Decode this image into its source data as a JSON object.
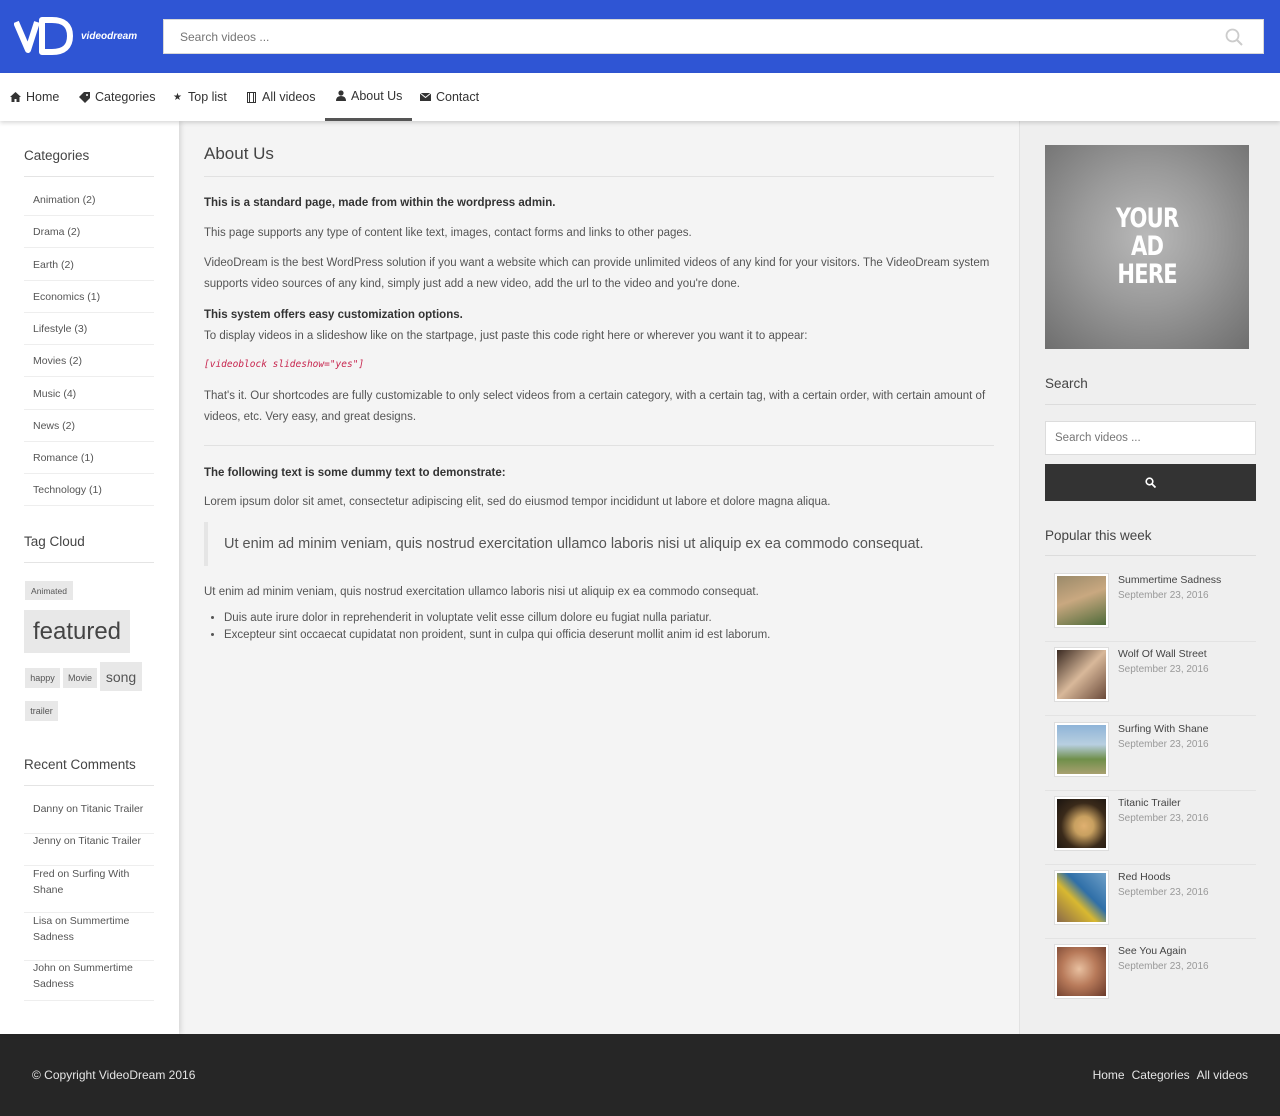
{
  "brand": {
    "name": "videodream",
    "logo_letters": "VD"
  },
  "search": {
    "placeholder": "Search videos ..."
  },
  "nav": [
    {
      "label": "Home",
      "icon": "home-icon"
    },
    {
      "label": "Categories",
      "icon": "tag-icon"
    },
    {
      "label": "Top list",
      "icon": "star-icon"
    },
    {
      "label": "All videos",
      "icon": "film-icon"
    },
    {
      "label": "About Us",
      "icon": "user-icon",
      "active": true
    },
    {
      "label": "Contact",
      "icon": "envelope-icon"
    }
  ],
  "left": {
    "categories_title": "Categories",
    "categories": [
      "Animation (2)",
      "Drama (2)",
      "Earth (2)",
      "Economics (1)",
      "Lifestyle (3)",
      "Movies (2)",
      "Music (4)",
      "News (2)",
      "Romance (1)",
      "Technology (1)"
    ],
    "tagcloud_title": "Tag Cloud",
    "tags": [
      "Animated",
      "featured",
      "happy",
      "Movie",
      "song",
      "trailer"
    ],
    "comments_title": "Recent Comments",
    "comments": [
      "Danny on Titanic Trailer",
      "Jenny on Titanic Trailer",
      "Fred on Surfing With Shane",
      "Lisa on Summertime Sadness",
      "John on Summertime Sadness"
    ]
  },
  "main": {
    "title": "About Us",
    "p1": "This is a standard page, made from within the wordpress admin.",
    "p2": "This page supports any type of content like text, images, contact forms and links to other pages.",
    "p3": "VideoDream is the best WordPress solution if you want a website which can provide unlimited videos of any kind for your visitors. The VideoDream system supports video sources of any kind, simply just add a new video, add the url to the video and you're done.",
    "p4_title": "This system offers easy customization options.",
    "p4": "To display videos in a slideshow like on the startpage, just paste this code right here or wherever you want it to appear:",
    "code": "[videoblock slideshow=\"yes\"]",
    "p5": "That's it. Our shortcodes are fully customizable to only select videos from a certain category, with a certain tag, with a certain order, with certain amount of videos, etc. Very easy, and great designs.",
    "p6_title": "The following text is some dummy text to demonstrate:",
    "p6": "Lorem ipsum dolor sit amet, consectetur adipiscing elit, sed do eiusmod tempor incididunt ut labore et dolore magna aliqua.",
    "quote": "Ut enim ad minim veniam, quis nostrud exercitation ullamco laboris nisi ut aliquip ex ea commodo consequat.",
    "p7": "Ut enim ad minim veniam, quis nostrud exercitation ullamco laboris nisi ut aliquip ex ea commodo consequat.",
    "bullets": [
      "Duis aute irure dolor in reprehenderit in voluptate velit esse cillum dolore eu fugiat nulla pariatur.",
      "Excepteur sint occaecat cupidatat non proident, sunt in culpa qui officia deserunt mollit anim id est laborum."
    ]
  },
  "right": {
    "ad_lines": [
      "YOUR",
      "AD",
      "HERE"
    ],
    "search_title": "Search",
    "search_placeholder": "Search videos ...",
    "popular_title": "Popular this week",
    "popular": [
      {
        "title": "Summertime Sadness",
        "date": "September 23, 2016",
        "colors": [
          "#8a7a5a",
          "#c9a880",
          "#4f6b3a"
        ]
      },
      {
        "title": "Wolf Of Wall Street",
        "date": "September 23, 2016",
        "colors": [
          "#6a4a3a",
          "#d8b89a",
          "#3a2a22"
        ]
      },
      {
        "title": "Surfing With Shane",
        "date": "September 23, 2016",
        "colors": [
          "#8fb4d8",
          "#6f8f4a",
          "#d8d0b8"
        ]
      },
      {
        "title": "Titanic Trailer",
        "date": "September 23, 2016",
        "colors": [
          "#3a2a1a",
          "#c8a060",
          "#1a1410"
        ]
      },
      {
        "title": "Red Hoods",
        "date": "September 23, 2016",
        "colors": [
          "#2f6fa8",
          "#d8b830",
          "#8a6a4a"
        ]
      },
      {
        "title": "See You Again",
        "date": "September 23, 2016",
        "colors": [
          "#6a3a2a",
          "#e0b090",
          "#b87a5a"
        ]
      }
    ]
  },
  "footer": {
    "copyright": "© Copyright VideoDream 2016",
    "links": [
      "Home",
      "Categories",
      "All videos"
    ]
  }
}
